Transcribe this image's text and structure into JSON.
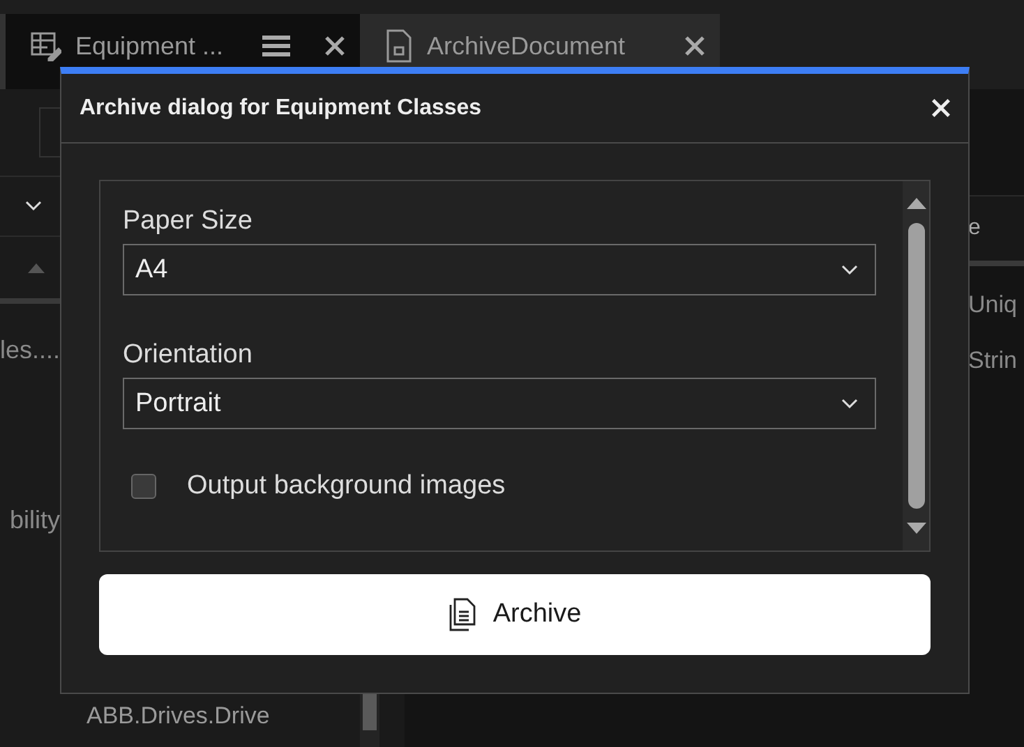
{
  "tabs": [
    {
      "label": "Equipment ...",
      "selected": true
    },
    {
      "label": "ArchiveDocument",
      "selected": false
    }
  ],
  "background": {
    "left_texts": [
      "les....",
      "bility"
    ],
    "right_header": "e",
    "right_texts": [
      "Uniq",
      "Strin"
    ],
    "bottom_text": "ABB.Drives.Drive"
  },
  "dialog": {
    "title": "Archive dialog for Equipment Classes",
    "fields": [
      {
        "label": "Paper Size",
        "value": "A4"
      },
      {
        "label": "Orientation",
        "value": "Portrait"
      }
    ],
    "checkbox": {
      "label": "Output background images",
      "checked": false
    },
    "button": "Archive"
  }
}
